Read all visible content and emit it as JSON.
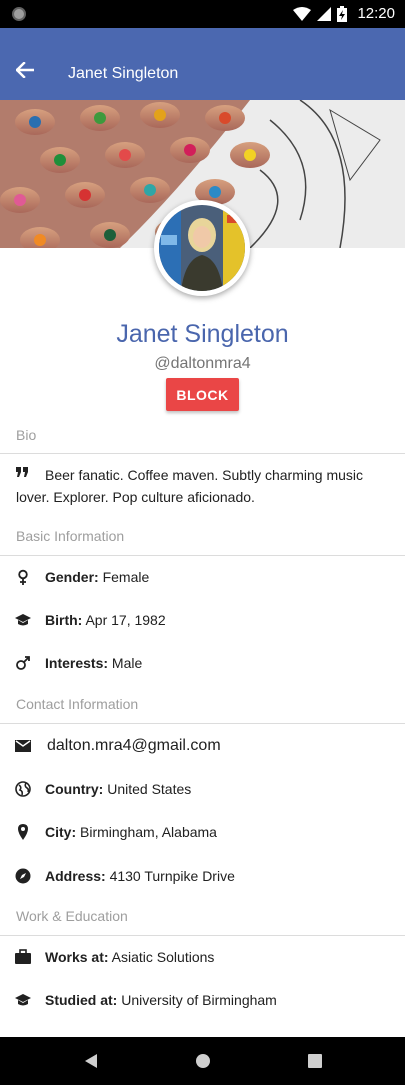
{
  "status_bar": {
    "time": "12:20"
  },
  "app_bar": {
    "title": "Janet Singleton"
  },
  "profile": {
    "name": "Janet Singleton",
    "handle": "@daltonmra4",
    "block_label": "BLOCK"
  },
  "sections": {
    "bio": "Bio",
    "basic": "Basic Information",
    "contact": "Contact Information",
    "work": "Work & Education"
  },
  "bio": {
    "text": "Beer fanatic. Coffee maven. Subtly charming music lover. Explorer. Pop culture aficionado."
  },
  "basic": {
    "gender": {
      "label": "Gender:",
      "value": "Female"
    },
    "birth": {
      "label": "Birth:",
      "value": "Apr 17, 1982"
    },
    "interests": {
      "label": "Interests:",
      "value": "Male"
    }
  },
  "contact": {
    "email": "dalton.mra4@gmail.com",
    "country": {
      "label": "Country:",
      "value": "United States"
    },
    "city": {
      "label": "City:",
      "value": "Birmingham, Alabama"
    },
    "address": {
      "label": "Address:",
      "value": "4130 Turnpike Drive"
    }
  },
  "work": {
    "works_at": {
      "label": "Works at:",
      "value": "Asiatic Solutions"
    },
    "studied_at": {
      "label": "Studied at:",
      "value": "University of Birmingham"
    }
  },
  "colors": {
    "app_bar": "#4b68b0",
    "name": "#4a66ad",
    "block": "#ea4646"
  }
}
